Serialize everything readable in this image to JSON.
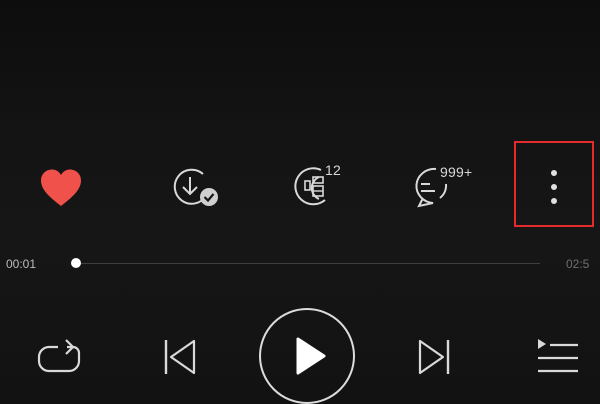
{
  "actions": {
    "like_icon": "heart-icon",
    "download_icon": "download-icon",
    "sing_icon": "karaoke-sing-icon",
    "sing_count": "12",
    "comment_icon": "comment-icon",
    "comment_count": "999+",
    "more_icon": "more-vertical-icon"
  },
  "progress": {
    "elapsed": "00:01",
    "total": "02:5",
    "fraction": 0.0
  },
  "transport": {
    "repeat_icon": "repeat-icon",
    "prev_icon": "previous-track-icon",
    "play_icon": "play-icon",
    "next_icon": "next-track-icon",
    "playlist_icon": "playlist-icon"
  },
  "colors": {
    "like": "#f0514a",
    "highlight_border": "#e32b2b",
    "background": "#111111",
    "icon": "#d9d9d9"
  }
}
